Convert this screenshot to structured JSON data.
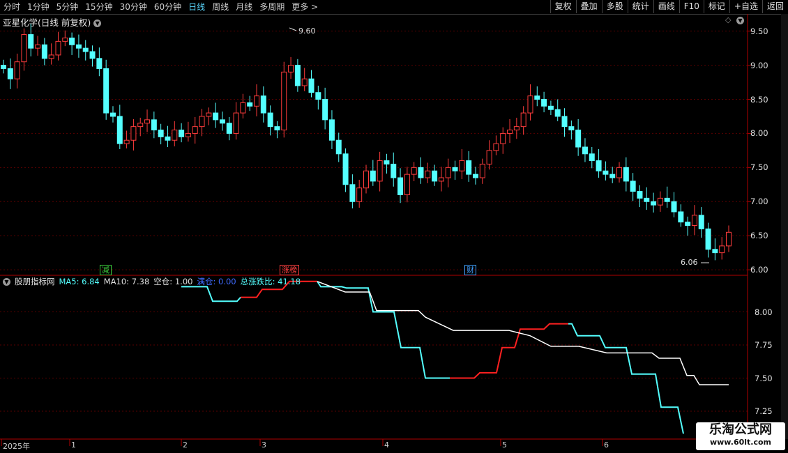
{
  "toolbar": {
    "periods": [
      "分时",
      "1分钟",
      "5分钟",
      "15分钟",
      "30分钟",
      "60分钟",
      "日线",
      "周线",
      "月线",
      "多周期",
      "更多 >"
    ],
    "active_period": "日线",
    "actions": [
      "复权",
      "叠加",
      "多股",
      "统计",
      "画线",
      "F10",
      "标记",
      "+自选",
      "返回"
    ]
  },
  "main_pane": {
    "title": "亚星化学(日线 前复权)",
    "high_label": "9.60",
    "low_label": "6.06",
    "price_axis": [
      "9.50",
      "9.00",
      "8.50",
      "8.00",
      "7.50",
      "7.00",
      "6.50",
      "6.00"
    ],
    "flags": [
      {
        "text": "减",
        "color": "#3ccc3c"
      },
      {
        "text": "涨榜",
        "color": "#ff4040"
      },
      {
        "text": "财",
        "color": "#40a0ff"
      }
    ]
  },
  "indicator_pane": {
    "name": "股朋指标网",
    "ma5_label": "MA5:",
    "ma5_value": "6.84",
    "ma10_label": "MA10:",
    "ma10_value": "7.38",
    "kongcang_label": "空仓:",
    "kongcang_value": "1.00",
    "mancang_label": "满仓:",
    "mancang_value": "0.00",
    "ratio_label": "总涨跌比:",
    "ratio_value": "41.18",
    "axis": [
      "8.00",
      "7.75",
      "7.50",
      "7.25"
    ]
  },
  "time_axis": [
    "2025年",
    "1",
    "2",
    "3",
    "4",
    "5",
    "6"
  ],
  "watermark": {
    "title": "乐淘公式网",
    "url": "www.60lt.com"
  },
  "colors": {
    "up": "#ff3c3c",
    "down": "#54ffff",
    "ma10": "#ffffff",
    "grid": "#5a0000",
    "border": "#8b0000"
  },
  "chart_data": {
    "type": "candlestick",
    "ohlc_up_down": "red=up, cyan=down",
    "candles_summary": {
      "high": 9.6,
      "low": 6.06,
      "last_close": 6.5
    },
    "indicator_series": [
      {
        "name": "MA5",
        "last": 6.84
      },
      {
        "name": "MA10",
        "last": 7.38
      }
    ],
    "price_range": [
      5.95,
      9.65
    ]
  }
}
